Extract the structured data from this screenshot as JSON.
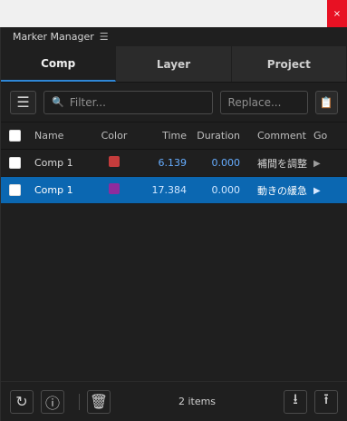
{
  "window": {
    "close": "×"
  },
  "panel": {
    "title": "Marker Manager",
    "menu_icon": "☰"
  },
  "tabs": [
    {
      "label": "Comp"
    },
    {
      "label": "Layer"
    },
    {
      "label": "Project"
    }
  ],
  "toolbar": {
    "filter_placeholder": "Filter...",
    "replace_placeholder": "Replace...",
    "menu_icon": "☰",
    "search_icon": "🔍",
    "clipboard_icon": "📋"
  },
  "table": {
    "headers": {
      "name": "Name",
      "color": "Color",
      "time": "Time",
      "duration": "Duration",
      "comment": "Comment",
      "go": "Go"
    },
    "rows": [
      {
        "name": "Comp 1",
        "color": "#c43c3c",
        "time": "6.139",
        "duration": "0.000",
        "comment": "補間を調整",
        "selected": false
      },
      {
        "name": "Comp 1",
        "color": "#8e2c9d",
        "time": "17.384",
        "duration": "0.000",
        "comment": "動きの緩急",
        "selected": true
      }
    ]
  },
  "footer": {
    "count_text": "2 items"
  }
}
